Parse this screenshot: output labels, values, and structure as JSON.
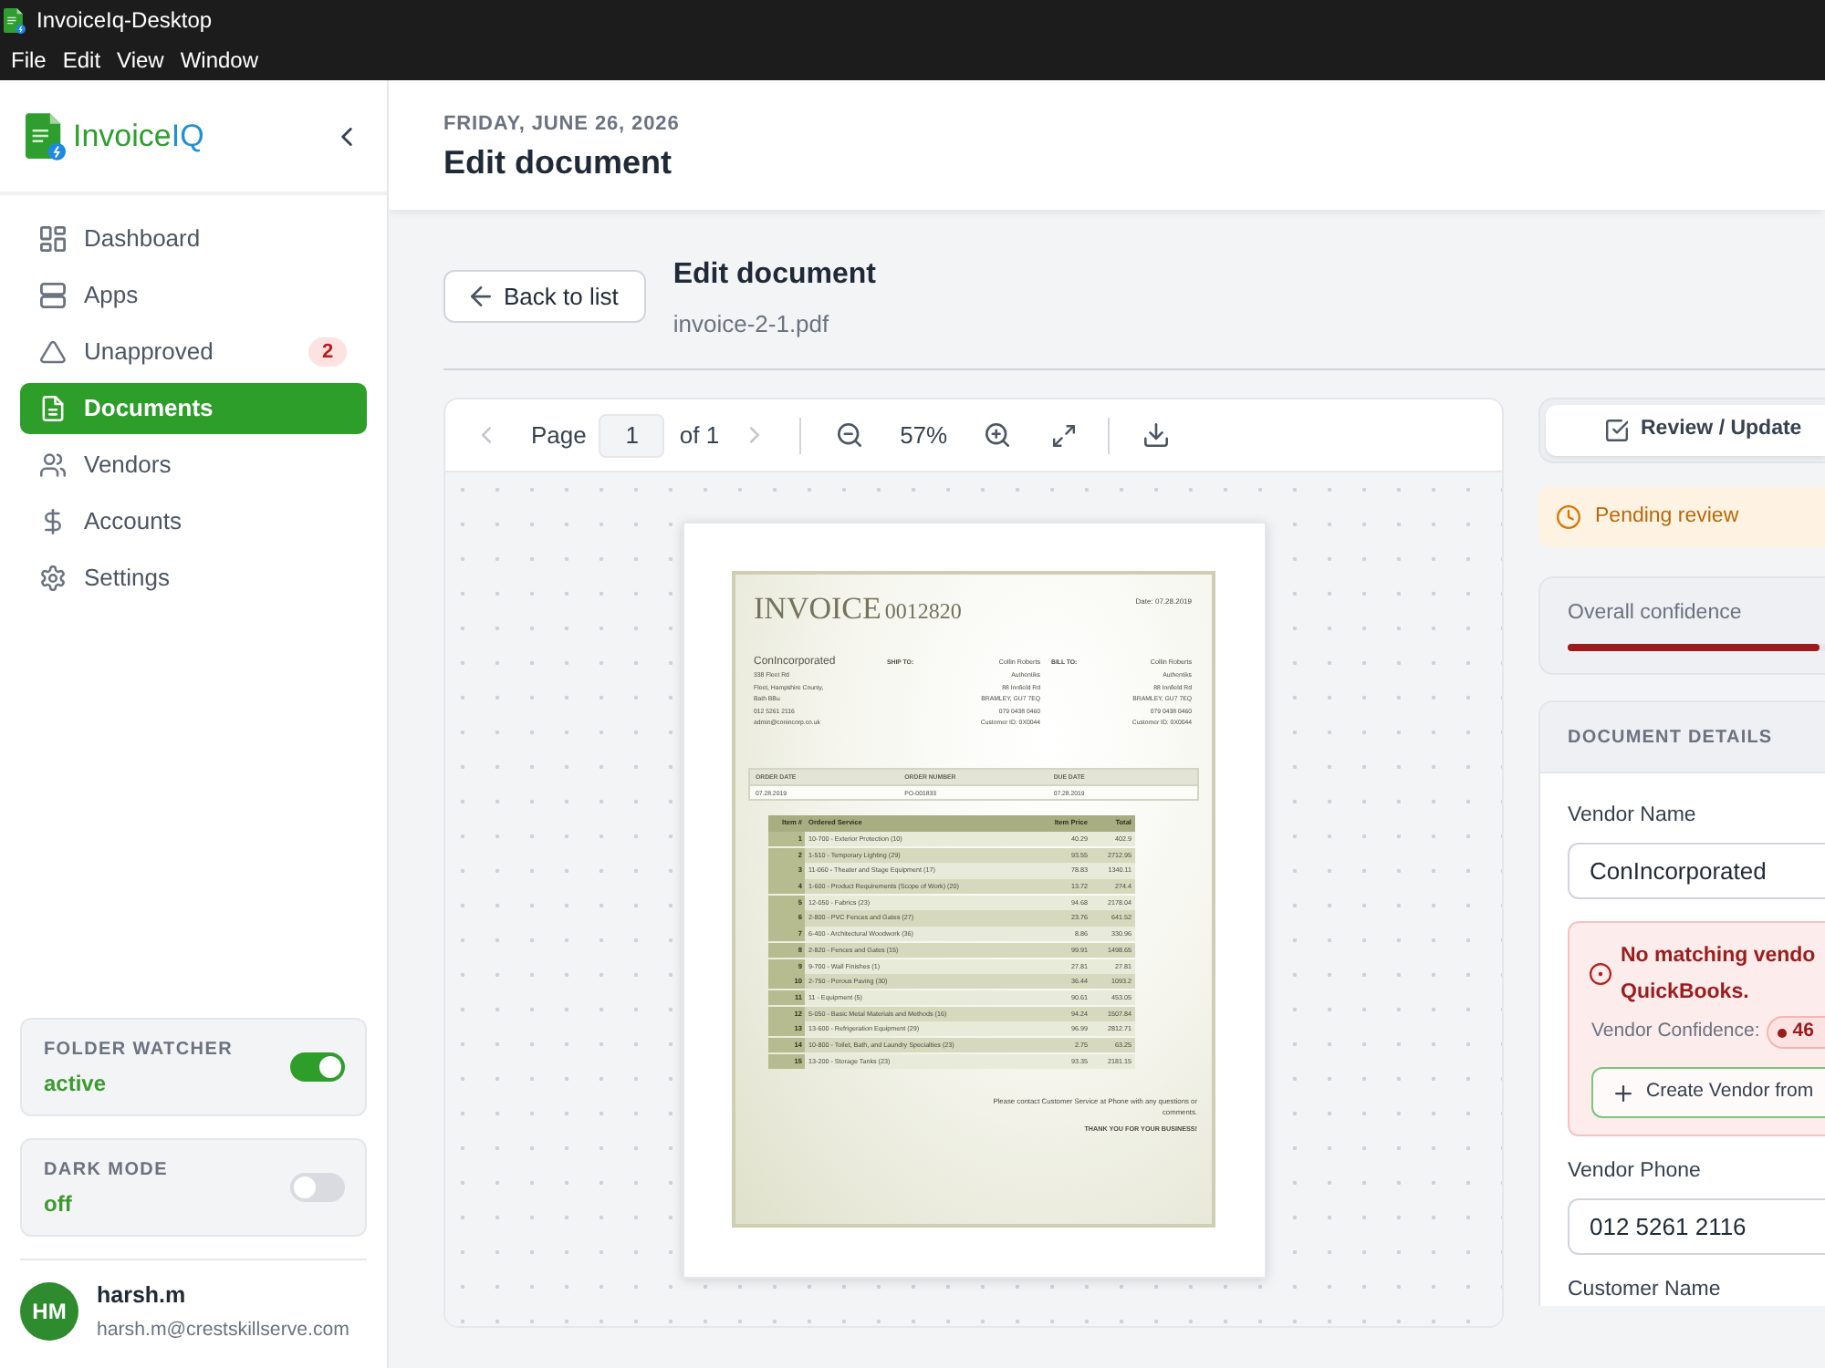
{
  "window": {
    "title": "InvoiceIq-Desktop"
  },
  "menu_bar": [
    "File",
    "Edit",
    "View",
    "Window"
  ],
  "sidebar": {
    "logo": {
      "text": "Invoice",
      "accent": "IQ"
    },
    "items": [
      {
        "label": "Dashboard",
        "selected": false
      },
      {
        "label": "Apps",
        "selected": false
      },
      {
        "label": "Unapproved",
        "selected": false,
        "badge": "2"
      },
      {
        "label": "Documents",
        "selected": true
      },
      {
        "label": "Vendors",
        "selected": false
      },
      {
        "label": "Accounts",
        "selected": false
      },
      {
        "label": "Settings",
        "selected": false
      }
    ],
    "toggles": [
      {
        "label": "FOLDER WATCHER",
        "status": "active",
        "on": true
      },
      {
        "label": "DARK MODE",
        "status": "off",
        "on": false
      }
    ],
    "user": {
      "initials": "HM",
      "name": "harsh.m",
      "email": "harsh.m@crestskillserve.com"
    }
  },
  "header": {
    "date": "FRIDAY, JUNE 26, 2026",
    "title": "Edit document"
  },
  "document": {
    "back_button": "Back to list",
    "title": "Edit document",
    "filename": "invoice-2-1.pdf"
  },
  "viewer": {
    "toolbar": {
      "page_label": "Page",
      "page": "1",
      "page_count": "of 1",
      "zoom": "57%"
    },
    "invoice": {
      "title": "INVOICE",
      "number": "0012820",
      "date": "Date: 07.28.2019",
      "vendor": {
        "name": "ConIncorporated",
        "lines": [
          "338 Fleet Rd",
          "Fleet, Hampshire County,",
          "Bath BBu",
          "012 5261 2116",
          "admin@conincorp.co.uk"
        ]
      },
      "ship_to": {
        "label": "SHIP TO:",
        "lines": [
          "Collin Roberts",
          "Authentiks",
          "88 Innfield Rd",
          "BRAMLEY, GU7 7EQ",
          "079 0438 0460",
          "Customer ID: 0X0044"
        ]
      },
      "bill_to": {
        "label": "BILL TO:",
        "lines": [
          "Collin Roberts",
          "Authentiks",
          "88 Innfield Rd",
          "BRAMLEY, GU7 7EQ",
          "079 0438 0460",
          "Customer ID: 0X0044"
        ]
      },
      "order_info": [
        {
          "label": "ORDER DATE",
          "value": "07.28.2019"
        },
        {
          "label": "ORDER NUMBER",
          "value": "PO-001833"
        },
        {
          "label": "DUE DATE",
          "value": "07.28.2019"
        }
      ],
      "items": {
        "columns": [
          "Item #",
          "Ordered Service",
          "Item Price",
          "Total"
        ],
        "rows": [
          [
            "1",
            "10-700 - Exterior Protection (10)",
            "40.29",
            "402.9"
          ],
          [
            "2",
            "1-510 - Temporary Lighting (29)",
            "93.55",
            "2712.95"
          ],
          [
            "3",
            "11-060 - Theater and Stage Equipment (17)",
            "78.83",
            "1340.11"
          ],
          [
            "4",
            "1-600 - Product Requirements (Scope of Work) (20)",
            "13.72",
            "274.4"
          ],
          [
            "5",
            "12-050 - Fabrics (23)",
            "94.68",
            "2178.04"
          ],
          [
            "6",
            "2-800 - PVC Fences and Gates (27)",
            "23.76",
            "641.52"
          ],
          [
            "7",
            "6-400 - Architectural Woodwork (36)",
            "8.86",
            "330.96"
          ],
          [
            "8",
            "2-820 - Fences and Gates (15)",
            "99.91",
            "1498.65"
          ],
          [
            "9",
            "9-700 - Wall Finishes (1)",
            "27.81",
            "27.81"
          ],
          [
            "10",
            "2-750 - Porous Paving (30)",
            "36.44",
            "1093.2"
          ],
          [
            "11",
            "11 - Equipment (5)",
            "90.61",
            "453.05"
          ],
          [
            "12",
            "5-050 - Basic Metal Materials and Methods (16)",
            "94.24",
            "1507.84"
          ],
          [
            "13",
            "13-600 - Refrigeration Equipment (29)",
            "96.99",
            "2812.71"
          ],
          [
            "14",
            "10-800 - Toilet, Bath, and Laundry Specialties (23)",
            "2.75",
            "63.25"
          ],
          [
            "15",
            "13-200 - Storage Tanks (23)",
            "93.35",
            "2181.15"
          ]
        ]
      },
      "footer": {
        "note": "Please contact Customer Service at Phone with any questions or comments.",
        "thanks": "THANK YOU FOR YOUR BUSINESS!"
      }
    }
  },
  "review_panel": {
    "tabs": [
      {
        "label": "Review / Update",
        "selected": true
      }
    ],
    "status": "Pending review",
    "confidence": {
      "label": "Overall confidence",
      "level": 0.46
    },
    "details": {
      "heading": "DOCUMENT DETAILS",
      "items": [
        {
          "kind": "field",
          "label": "Vendor Name",
          "value": "ConIncorporated"
        },
        {
          "kind": "alert",
          "message": "No matching vendo QuickBooks.",
          "confidence_label": "Vendor Confidence:",
          "confidence": "46",
          "button": "Create Vendor from"
        },
        {
          "kind": "field",
          "label": "Vendor Phone",
          "value": "012 5261 2116"
        },
        {
          "kind": "label",
          "label": "Customer Name"
        }
      ]
    }
  }
}
